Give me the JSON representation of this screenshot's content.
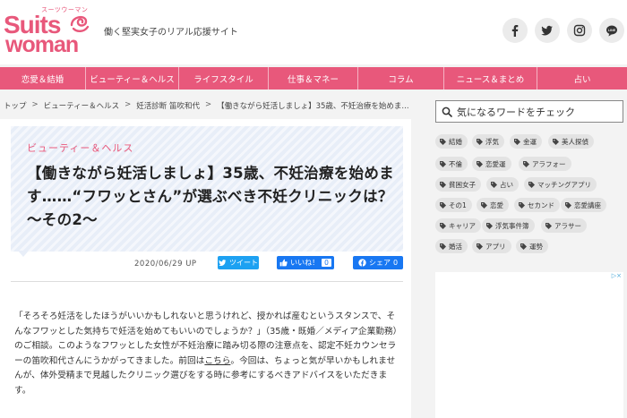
{
  "logo": {
    "kana": "スーツウーマン",
    "line1": "Suits",
    "line2": "woman"
  },
  "tagline": "働く堅実女子のリアル応援サイト",
  "social": [
    {
      "name": "facebook-icon"
    },
    {
      "name": "twitter-icon"
    },
    {
      "name": "instagram-icon"
    },
    {
      "name": "line-icon",
      "label": "LINE"
    }
  ],
  "nav": [
    "恋愛＆結婚",
    "ビューティー＆ヘルス",
    "ライフスタイル",
    "仕事＆マネー",
    "コラム",
    "ニュース＆まとめ",
    "占い"
  ],
  "breadcrumb": [
    "トップ",
    "ビューティー＆ヘルス",
    "妊活診断 笛吹和代",
    "【働きながら妊活しましょ】35歳、不妊治療を始めま..."
  ],
  "article": {
    "category": "ビューティー＆ヘルス",
    "title": "【働きながら妊活しましょ】35歳、不妊治療を始めます……“フワッとさん”が選ぶべき不妊クリニックは？～その2～",
    "date": "2020/06/29 UP",
    "tweet_label": "ツイート",
    "like_label": "いいね！",
    "like_count": "0",
    "share_label": "シェア",
    "share_count": "0",
    "body_before_link": "「そろそろ妊活をしたほうがいいかもしれないと思うけれど、授かれば産むというスタンスで、そんなフワッとした気持ちで妊活を始めてもいいのでしょうか？」（35歳・既婚／メディア企業勤務）のご相談。このようなフワッとした女性が不妊治療に踏み切る際の注意点を、認定不妊カウンセラーの笛吹和代さんにうかがってきました。前回は",
    "body_link": "こちら",
    "body_after_link": "。今回は、ちょっと気が早いかもしれませんが、体外受精まで見越したクリニック選びをする時に参考にするべきアドバイスをいただきます。"
  },
  "sidebar": {
    "search_placeholder": "気になるワードをチェック",
    "tags": [
      "結婚",
      "浮気",
      "金運",
      "美人探偵",
      "不倫",
      "恋愛運",
      "アラフォー",
      "貧困女子",
      "占い",
      "マッチングアプリ",
      "その1",
      "恋愛",
      "セカンド",
      "恋愛講座",
      "キャリア",
      "浮気事件簿",
      "アラサー",
      "婚活",
      "アプリ",
      "運勢"
    ],
    "ad_mark": "▷×"
  },
  "colors": {
    "brand": "#e8587b",
    "hero_bg": "#e8eef8",
    "twitter": "#1da1f2",
    "facebook": "#1877f2"
  }
}
